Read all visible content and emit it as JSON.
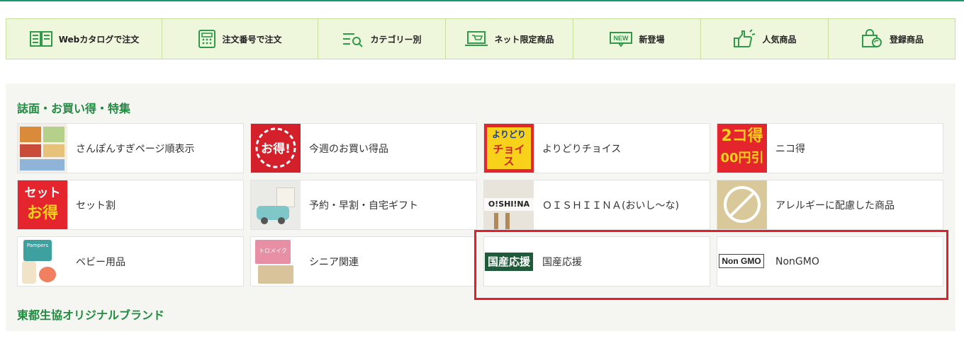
{
  "nav": [
    {
      "label": "Webカタログで注文",
      "icon": "catalog-book-icon"
    },
    {
      "label": "注文番号で注文",
      "icon": "calculator-icon"
    },
    {
      "label": "カテゴリー別",
      "icon": "category-search-icon"
    },
    {
      "label": "ネット限定商品",
      "icon": "laptop-cart-icon"
    },
    {
      "label": "新登場",
      "icon": "new-badge-icon"
    },
    {
      "label": "人気商品",
      "icon": "thumbs-up-icon"
    },
    {
      "label": "登録商品",
      "icon": "shopping-bag-refresh-icon"
    }
  ],
  "section1": {
    "title": "誌面・お買い得・特集",
    "cards": [
      {
        "label": "さんぽんすぎページ順表示",
        "thumb_text": ""
      },
      {
        "label": "今週のお買い得品",
        "thumb_text": "お得!"
      },
      {
        "label": "よりどりチョイス",
        "thumb_text": "よりどりチョイス"
      },
      {
        "label": "ニコ得",
        "thumb_text": "2コ得 00円引"
      },
      {
        "label": "セット割",
        "thumb_text": "セットでお得"
      },
      {
        "label": "予約・早割・自宅ギフト",
        "thumb_text": ""
      },
      {
        "label": "ＯＩＳＨＩＩＮＡ(おいし〜な)",
        "thumb_text": "O!SHI!NA"
      },
      {
        "label": "アレルギーに配慮した商品",
        "thumb_text": ""
      },
      {
        "label": "ベビー用品",
        "thumb_text": "Pampers"
      },
      {
        "label": "シニア関連",
        "thumb_text": "トロメイク"
      },
      {
        "label": "国産応援",
        "thumb_text": "国産応援"
      },
      {
        "label": "NonGMO",
        "thumb_text": "Non GMO"
      }
    ]
  },
  "section2": {
    "title": "東都生協オリジナルブランド"
  },
  "colors": {
    "accent_green": "#1f8c3f",
    "nav_bg": "#eef6dc",
    "highlight_red": "#e0202a"
  }
}
